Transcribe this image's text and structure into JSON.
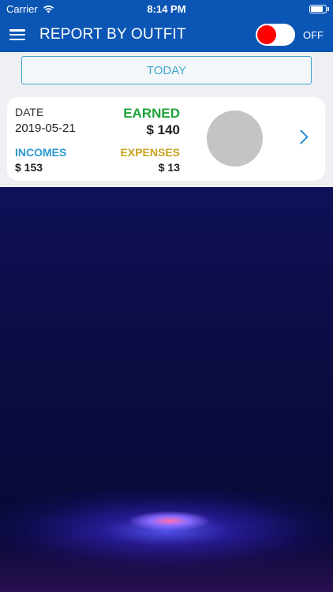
{
  "status_bar": {
    "carrier": "Carrier",
    "time": "8:14 PM",
    "battery_level": 0.9
  },
  "nav": {
    "title": "REPORT BY OUTFIT",
    "toggle_label": "OFF",
    "toggle_on": false,
    "icons": {
      "menu": "hamburger-menu-icon",
      "wifi": "wifi-icon",
      "battery": "battery-icon"
    }
  },
  "today_button": {
    "label": "TODAY"
  },
  "report_card": {
    "date_label": "DATE",
    "date_value": "2019-05-21",
    "earned_label": "EARNED",
    "earned_value": "$ 140",
    "incomes_label": "INCOMES",
    "incomes_value": "$ 153",
    "expenses_label": "EXPENSES",
    "expenses_value": "$ 13"
  },
  "colors": {
    "primary": "#0b56b5",
    "accent": "#3fa6cf",
    "earned": "#1fa33a",
    "incomes": "#2a9ad0",
    "expenses": "#c7a21c",
    "toggle_knob": "#ff0000"
  }
}
